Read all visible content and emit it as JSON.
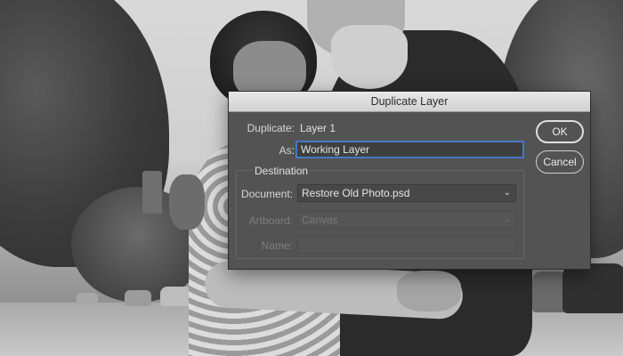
{
  "dialog": {
    "title": "Duplicate Layer",
    "duplicate_label": "Duplicate:",
    "duplicate_value": "Layer 1",
    "as_label": "As:",
    "as_value": "Working Layer",
    "destination_title": "Destination",
    "document_label": "Document:",
    "document_value": "Restore Old Photo.psd",
    "artboard_label": "Artboard:",
    "artboard_value": "Canvas",
    "name_label": "Name:",
    "name_value": "",
    "ok_label": "OK",
    "cancel_label": "Cancel"
  },
  "colors": {
    "dialog_bg": "#535353",
    "focus_ring": "#4479c2"
  }
}
